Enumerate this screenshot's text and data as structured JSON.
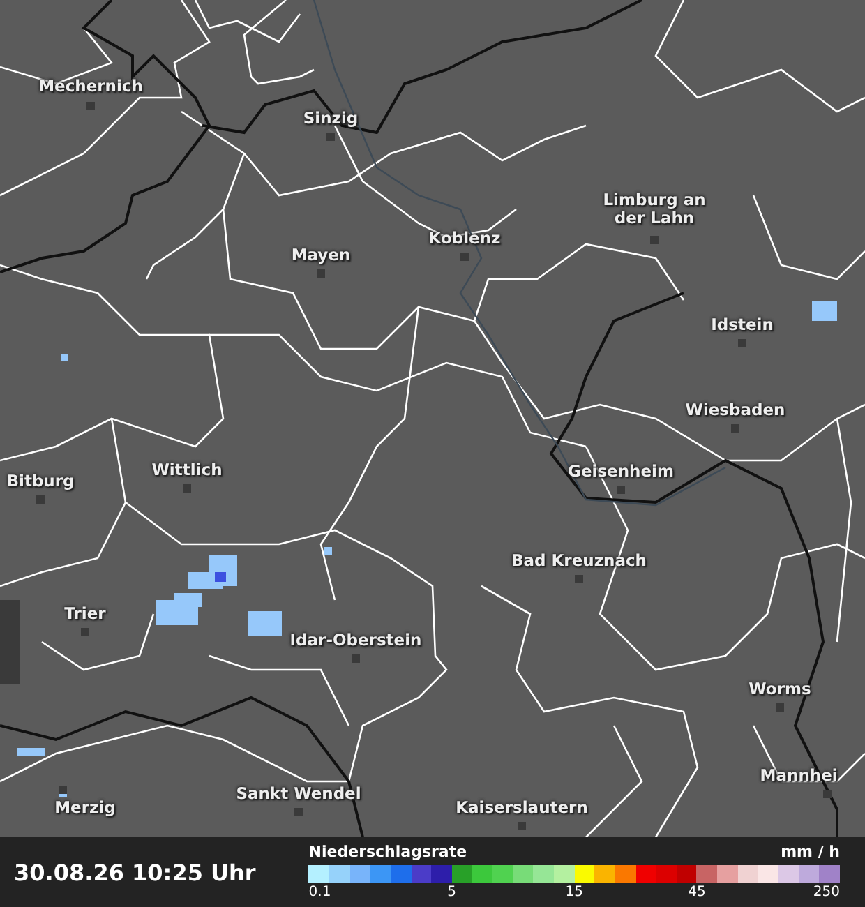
{
  "map": {
    "cities": [
      {
        "name": "Mechernich"
      },
      {
        "name": "Sinzig"
      },
      {
        "name": "Limburg an der Lahn"
      },
      {
        "name": "Mayen"
      },
      {
        "name": "Koblenz"
      },
      {
        "name": "Idstein"
      },
      {
        "name": "Wiesbaden"
      },
      {
        "name": "Bitburg"
      },
      {
        "name": "Wittlich"
      },
      {
        "name": "Geisenheim"
      },
      {
        "name": "Bad Kreuznach"
      },
      {
        "name": "Trier"
      },
      {
        "name": "Idar-Oberstein"
      },
      {
        "name": "Worms"
      },
      {
        "name": "Merzig"
      },
      {
        "name": "Sankt Wendel"
      },
      {
        "name": "Kaiserslautern"
      },
      {
        "name": "Mannhei"
      }
    ]
  },
  "status_bar": {
    "timestamp": "30.08.26 10:25 Uhr"
  },
  "legend": {
    "title": "Niederschlagsrate",
    "unit": "mm / h",
    "swatches": [
      {
        "color": "#b4f0ff"
      },
      {
        "color": "#96d2fa"
      },
      {
        "color": "#78b4fa"
      },
      {
        "color": "#3c96f5"
      },
      {
        "color": "#1e6eeb"
      },
      {
        "color": "#4b3cc8"
      },
      {
        "color": "#2d1eaa"
      },
      {
        "color": "#28a028"
      },
      {
        "color": "#3cc83c"
      },
      {
        "color": "#50d250"
      },
      {
        "color": "#78dc78"
      },
      {
        "color": "#96e696"
      },
      {
        "color": "#b4f0a0"
      },
      {
        "color": "#fafa00"
      },
      {
        "color": "#fab400"
      },
      {
        "color": "#fa7800"
      },
      {
        "color": "#f00000"
      },
      {
        "color": "#dc0000"
      },
      {
        "color": "#c00000"
      },
      {
        "color": "#c86464"
      },
      {
        "color": "#e6a0a0"
      },
      {
        "color": "#f0d2d2"
      },
      {
        "color": "#fae6e6"
      },
      {
        "color": "#dcc8e6"
      },
      {
        "color": "#beaadc"
      },
      {
        "color": "#a082c8"
      }
    ],
    "ticks": [
      {
        "label": "0.1"
      },
      {
        "label": "5"
      },
      {
        "label": "15"
      },
      {
        "label": "45"
      },
      {
        "label": "250"
      }
    ]
  }
}
